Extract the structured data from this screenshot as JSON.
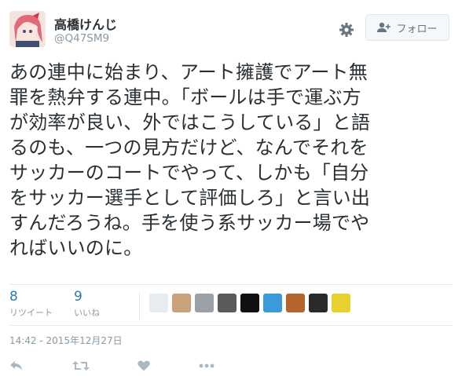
{
  "user": {
    "display_name": "高橋けんじ",
    "screen_name": "@Q47SM9"
  },
  "follow_button": {
    "label": "フォロー",
    "icon": "add-user-icon"
  },
  "settings_icon": "gear-icon",
  "tweet": {
    "lines": [
      "あの連中に始まり、アート擁護でアート無",
      "罪を熱弁する連中。「ボールは手で運ぶ方",
      "が効率が良い、外ではこうしている」と語",
      "るのも、一つの見方だけど、なんでそれを",
      "サッカーのコートでやって、しかも「自分",
      "をサッカー選手として評価しろ」と言い出",
      "すんだろうね。手を使う系サッカー場でや",
      "ればいいのに。"
    ]
  },
  "stats": {
    "retweets": {
      "count": "8",
      "label": "リツイート"
    },
    "likes": {
      "count": "9",
      "label": "いいね"
    }
  },
  "liker_avatars": [
    {
      "name": "liker-avatar-1",
      "color": "#e8ecef"
    },
    {
      "name": "liker-avatar-2",
      "color": "#c9a27a"
    },
    {
      "name": "liker-avatar-3",
      "color": "#9aa0a6"
    },
    {
      "name": "liker-avatar-4",
      "color": "#5a5a5a"
    },
    {
      "name": "liker-avatar-5",
      "color": "#111111"
    },
    {
      "name": "liker-avatar-6",
      "color": "#3b9ad9"
    },
    {
      "name": "liker-avatar-7",
      "color": "#b5652b"
    },
    {
      "name": "liker-avatar-8",
      "color": "#2a2a2a"
    },
    {
      "name": "liker-avatar-9",
      "color": "#e8d12f"
    }
  ],
  "timestamp": "14:42 - 2015年12月27日",
  "actions": [
    "reply-icon",
    "retweet-icon",
    "like-icon",
    "more-icon"
  ]
}
